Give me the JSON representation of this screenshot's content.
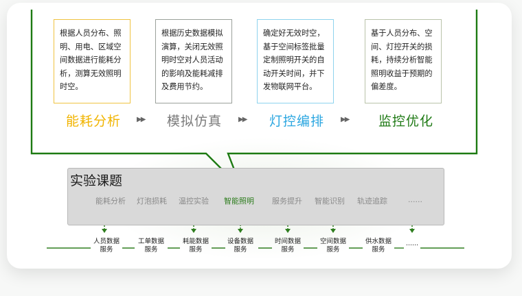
{
  "steps": [
    {
      "text": "根据人员分布、照明、用电、区域空间数据进行能耗分析，测算无效照明时空。",
      "label": "能耗分析",
      "color": "#f1b400"
    },
    {
      "text": "根据历史数据模拟演算，关闭无效照明时空对人员活动的影响及能耗减排及费用节约。",
      "label": "模拟仿真",
      "color": "#7a7a7a"
    },
    {
      "text": "确定好无效时空，基于空间标签批量定制照明开关的自动开关时间，并下发物联网平台。",
      "label": "灯控编排",
      "color": "#2aa6e0"
    },
    {
      "text": "基于人员分布、空间、灯控开关的损耗，持续分析智能照明收益于预期的偏差度。",
      "label": "监控优化",
      "color": "#1f7a15"
    }
  ],
  "arrow_glyph": "▶▶",
  "panel": {
    "title": "实验课题",
    "topics": [
      "能耗分析",
      "灯泡损耗",
      "温控实验",
      "智能照明",
      "服务提升",
      "智能识别",
      "轨迹追踪",
      "......"
    ],
    "active_topic_index": 3
  },
  "services": [
    {
      "line1": "人员数据",
      "line2": "服务"
    },
    {
      "line1": "工单数据",
      "line2": "服务"
    },
    {
      "line1": "耗能数据",
      "line2": "服务"
    },
    {
      "line1": "设备数据",
      "line2": "服务"
    },
    {
      "line1": "时间数据",
      "line2": "服务"
    },
    {
      "line1": "空间数据",
      "line2": "服务"
    },
    {
      "line1": "供水数据",
      "line2": "服务"
    },
    {
      "line1": "......",
      "line2": ""
    }
  ],
  "colors": {
    "frame": "#1d7a12",
    "link": "#2e7d1e"
  }
}
